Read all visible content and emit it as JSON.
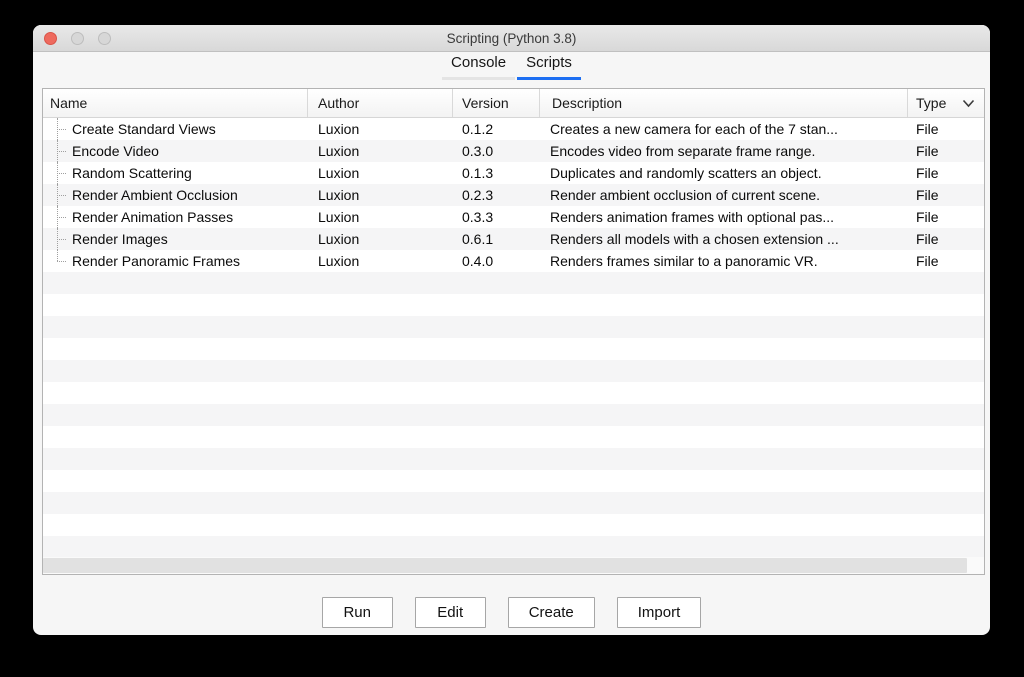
{
  "window": {
    "title": "Scripting (Python 3.8)"
  },
  "tabs": [
    {
      "label": "Console",
      "active": false
    },
    {
      "label": "Scripts",
      "active": true
    }
  ],
  "table": {
    "columns": [
      "Name",
      "Author",
      "Version",
      "Description",
      "Type"
    ],
    "rows": [
      [
        "Create Standard Views",
        "Luxion",
        "0.1.2",
        "Creates a new camera for each of the 7 stan...",
        "File"
      ],
      [
        "Encode Video",
        "Luxion",
        "0.3.0",
        "Encodes video from separate frame range.",
        "File"
      ],
      [
        "Random Scattering",
        "Luxion",
        "0.1.3",
        "Duplicates and randomly scatters an object.",
        "File"
      ],
      [
        "Render Ambient Occlusion",
        "Luxion",
        "0.2.3",
        "Render ambient occlusion of current scene.",
        "File"
      ],
      [
        "Render Animation Passes",
        "Luxion",
        "0.3.3",
        "Renders animation frames with optional pas...",
        "File"
      ],
      [
        "Render Images",
        "Luxion",
        "0.6.1",
        "Renders all models with a chosen extension ...",
        "File"
      ],
      [
        "Render Panoramic Frames",
        "Luxion",
        "0.4.0",
        "Renders frames similar to a panoramic VR.",
        "File"
      ]
    ]
  },
  "buttons": [
    "Run",
    "Edit",
    "Create",
    "Import"
  ],
  "icons": {
    "type_header_chevron": "chevron-down",
    "close": "close-circle",
    "minimize": "gray-circle",
    "zoom": "gray-circle"
  },
  "colors": {
    "tab_active_underline": "#1d6ff2",
    "tab_inactive_underline": "#e4e4e4",
    "close_button": "#ee6a5e",
    "row_stripe": "#f5f5f6"
  }
}
